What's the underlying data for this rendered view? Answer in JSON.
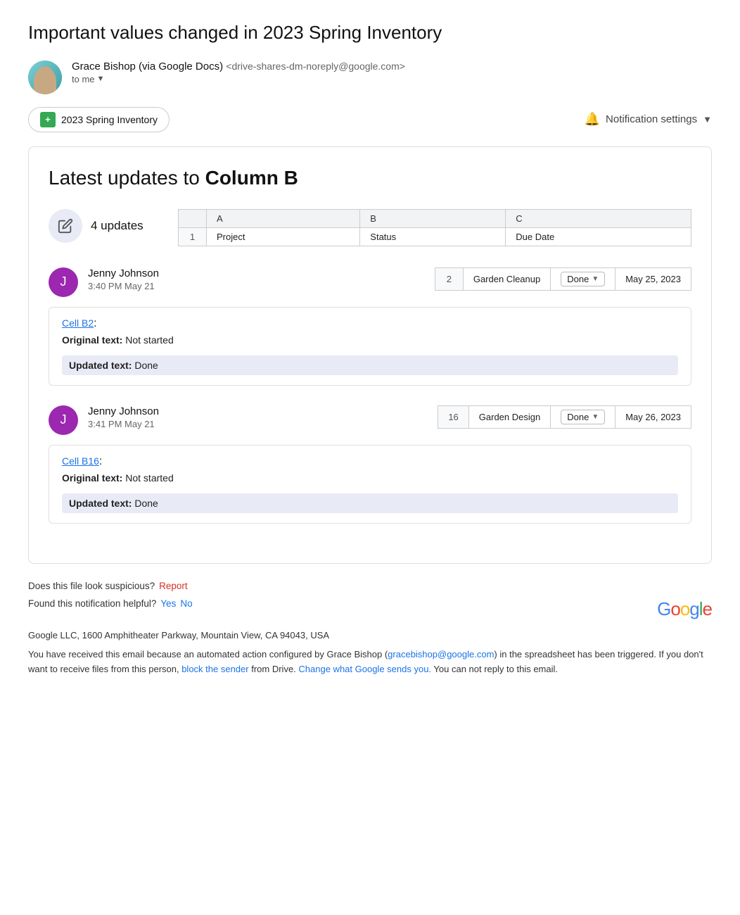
{
  "email": {
    "title": "Important values changed in 2023 Spring Inventory",
    "sender": {
      "name": "Grace Bishop (via Google Docs)",
      "email": "<drive-shares-dm-noreply@google.com>",
      "to_label": "to me"
    },
    "sheet_button": "2023 Spring Inventory",
    "notification_button": "Notification settings"
  },
  "card": {
    "title_prefix": "Latest updates to ",
    "title_bold": "Column B",
    "updates_count": "4 updates",
    "table_headers": [
      "",
      "A",
      "B",
      "C"
    ],
    "table_col_labels": [
      "",
      "Project",
      "Status",
      "Due Date"
    ]
  },
  "updates": [
    {
      "user_initial": "J",
      "user_name": "Jenny Johnson",
      "time": "3:40 PM May 21",
      "row_num": "2",
      "project": "Garden Cleanup",
      "status": "Done",
      "due_date": "May 25, 2023",
      "cell_link": "Cell B2",
      "original_label": "Original text:",
      "original_value": "Not started",
      "updated_label": "Updated text:",
      "updated_value": "Done"
    },
    {
      "user_initial": "J",
      "user_name": "Jenny Johnson",
      "time": "3:41 PM May 21",
      "row_num": "16",
      "project": "Garden Design",
      "status": "Done",
      "due_date": "May 26, 2023",
      "cell_link": "Cell B16",
      "original_label": "Original text:",
      "original_value": "Not started",
      "updated_label": "Updated text:",
      "updated_value": "Done"
    }
  ],
  "footer": {
    "suspicious_text": "Does this file look suspicious?",
    "report_label": "Report",
    "helpful_text": "Found this notification helpful?",
    "yes_label": "Yes",
    "no_label": "No",
    "google_logo": "Google",
    "address": "Google LLC, 1600 Amphitheater Parkway, Mountain View, CA 94043, USA",
    "disclaimer": "You have received this email because an automated action configured by Grace Bishop (gracebishop@google.com) in the spreadsheet has been triggered. If you don't want to receive files from this person, block the sender from Drive. Change what Google sends you. You can not reply to this email.",
    "grace_email": "gracebishop@google.com",
    "block_sender": "block the sender",
    "change_settings": "Change what Google sends you."
  }
}
